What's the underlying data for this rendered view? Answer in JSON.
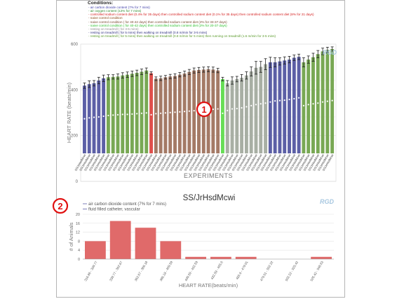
{
  "top": {
    "legend_title": "Conditions:",
    "legend_items": [
      {
        "text": "air carbon dioxide content (7% for 7 mins)",
        "color": "#4040a8"
      },
      {
        "text": "air oxygen content (12% for 7 mins)",
        "color": "#2e8b2e"
      },
      {
        "text": "controlled sodium content diet (0.4% for 35 days) then controlled sodium content diet (0.1% for 35 days) then controlled sodium content diet (8% for 21 days)",
        "color": "#d42020"
      },
      {
        "text": "naive control condition",
        "color": "#8b4513"
      },
      {
        "text": "naive control condition ( for 40-42 days) then controlled sodium content diet (2% for 33-37 days)",
        "color": "#7a4a30"
      },
      {
        "text": "naive control condition ( for 40-42 days) then controlled sodium content diet (2% for 20-37 days)",
        "color": "#30c030"
      },
      {
        "text": "resting on treadmill ( for 3-5 mins)",
        "color": "#909090"
      },
      {
        "text": "resting on treadmill ( for 5 mins) then walking on treadmill (0.8 m/min for 3-5 mins)",
        "color": "#303080"
      },
      {
        "text": "resting on treadmill ( for 5 mins) then walking on treadmill (0.8 m/min for 5 mins) then running on treadmill (1.6 m/min for 3-5 mins)",
        "color": "#5a9a2a"
      }
    ],
    "logo": "RGD",
    "ylabel": "HEART RATE (beats/min)",
    "xlabel": "EXPERIMENTS",
    "yticks": [
      "600",
      "400",
      "200",
      "0"
    ],
    "bar_label": "SS/JrHsdMcwi",
    "marker": "1"
  },
  "bottom": {
    "title": "SS/JrHsdMcwi",
    "marker": "2",
    "logo": "RGD",
    "legend_lines": [
      "air carbon dioxide content (7% for 7 mins)",
      "fluid filled catheter, vascular"
    ],
    "ylabel": "# of Animals",
    "xlabel": "HEART RATE(beats/min)",
    "yticks": [
      "20",
      "16",
      "12",
      "8",
      "4",
      "0"
    ]
  },
  "colors": {
    "blue": "#5c5fa6",
    "green": "#78a854",
    "red": "#e0504c",
    "brown": "#a47a66",
    "bright_green": "#66dd55",
    "gray": "#a8afa4",
    "hist": "#e06a6a",
    "marker": "#e01010"
  },
  "chart_data": [
    {
      "type": "bar",
      "title": "",
      "xlabel": "EXPERIMENTS",
      "ylabel": "HEART RATE (beats/min)",
      "ylim": [
        0,
        600
      ],
      "grid": true,
      "category_label": "SS/JrHsdMcwi",
      "series": [
        {
          "values": [
            372,
            380,
            385,
            400,
            412,
            418,
            420,
            422,
            428,
            432,
            437,
            442,
            448,
            455,
            440,
            410,
            412,
            418,
            422,
            425,
            432,
            438,
            447,
            455,
            458,
            460,
            462,
            460,
            455,
            408,
            385,
            400,
            408,
            415,
            428,
            450,
            470,
            475,
            490,
            500,
            500,
            505,
            510,
            515,
            525,
            530,
            500,
            515,
            528,
            545,
            560,
            568,
            573
          ],
          "errors": [
            15,
            18,
            15,
            18,
            18,
            14,
            12,
            14,
            15,
            15,
            15,
            15,
            15,
            14,
            8,
            10,
            12,
            10,
            12,
            12,
            12,
            14,
            14,
            14,
            14,
            14,
            14,
            14,
            12,
            10,
            15,
            20,
            15,
            18,
            20,
            25,
            35,
            30,
            30,
            28,
            25,
            20,
            20,
            18,
            15,
            15,
            25,
            20,
            22,
            20,
            18,
            15,
            12
          ],
          "dots": [
            190,
            195,
            198,
            200,
            204,
            208,
            210,
            212,
            214,
            214,
            216,
            218,
            220,
            222,
            212,
            218,
            220,
            222,
            224,
            226,
            228,
            230,
            232,
            234,
            236,
            238,
            240,
            242,
            244,
            220,
            235,
            244,
            246,
            250,
            256,
            262,
            268,
            272,
            276,
            282,
            288,
            290,
            292,
            296,
            300,
            305,
            262,
            268,
            272,
            276,
            282,
            286,
            290
          ],
          "colors": [
            "blue",
            "blue",
            "blue",
            "blue",
            "blue",
            "green",
            "green",
            "green",
            "green",
            "green",
            "green",
            "green",
            "green",
            "green",
            "red",
            "brown",
            "brown",
            "brown",
            "brown",
            "brown",
            "brown",
            "brown",
            "brown",
            "brown",
            "brown",
            "brown",
            "brown",
            "brown",
            "brown",
            "bright_green",
            "gray",
            "gray",
            "gray",
            "gray",
            "gray",
            "gray",
            "gray",
            "gray",
            "gray",
            "blue",
            "blue",
            "blue",
            "blue",
            "blue",
            "blue",
            "blue",
            "green",
            "green",
            "green",
            "green",
            "green",
            "green",
            "green"
          ]
        }
      ]
    },
    {
      "type": "bar",
      "title": "SS/JrHsdMcwi",
      "xlabel": "HEART RATE(beats/min)",
      "ylabel": "# of Animals",
      "ylim": [
        0,
        20
      ],
      "grid": true,
      "categories": [
        "316.86 - 339.77",
        "339.77 - 362.67",
        "362.67 - 386.18",
        "386.18 - 409.59",
        "409.59 - 432.59",
        "432.59 - 455.6",
        "455.6 - 479.01",
        "479.01 - 502.22",
        "502.22 - 525.42",
        "525.42 - 548.63"
      ],
      "values": [
        8,
        17,
        14,
        8,
        1,
        1,
        1,
        0,
        0,
        1
      ]
    }
  ]
}
